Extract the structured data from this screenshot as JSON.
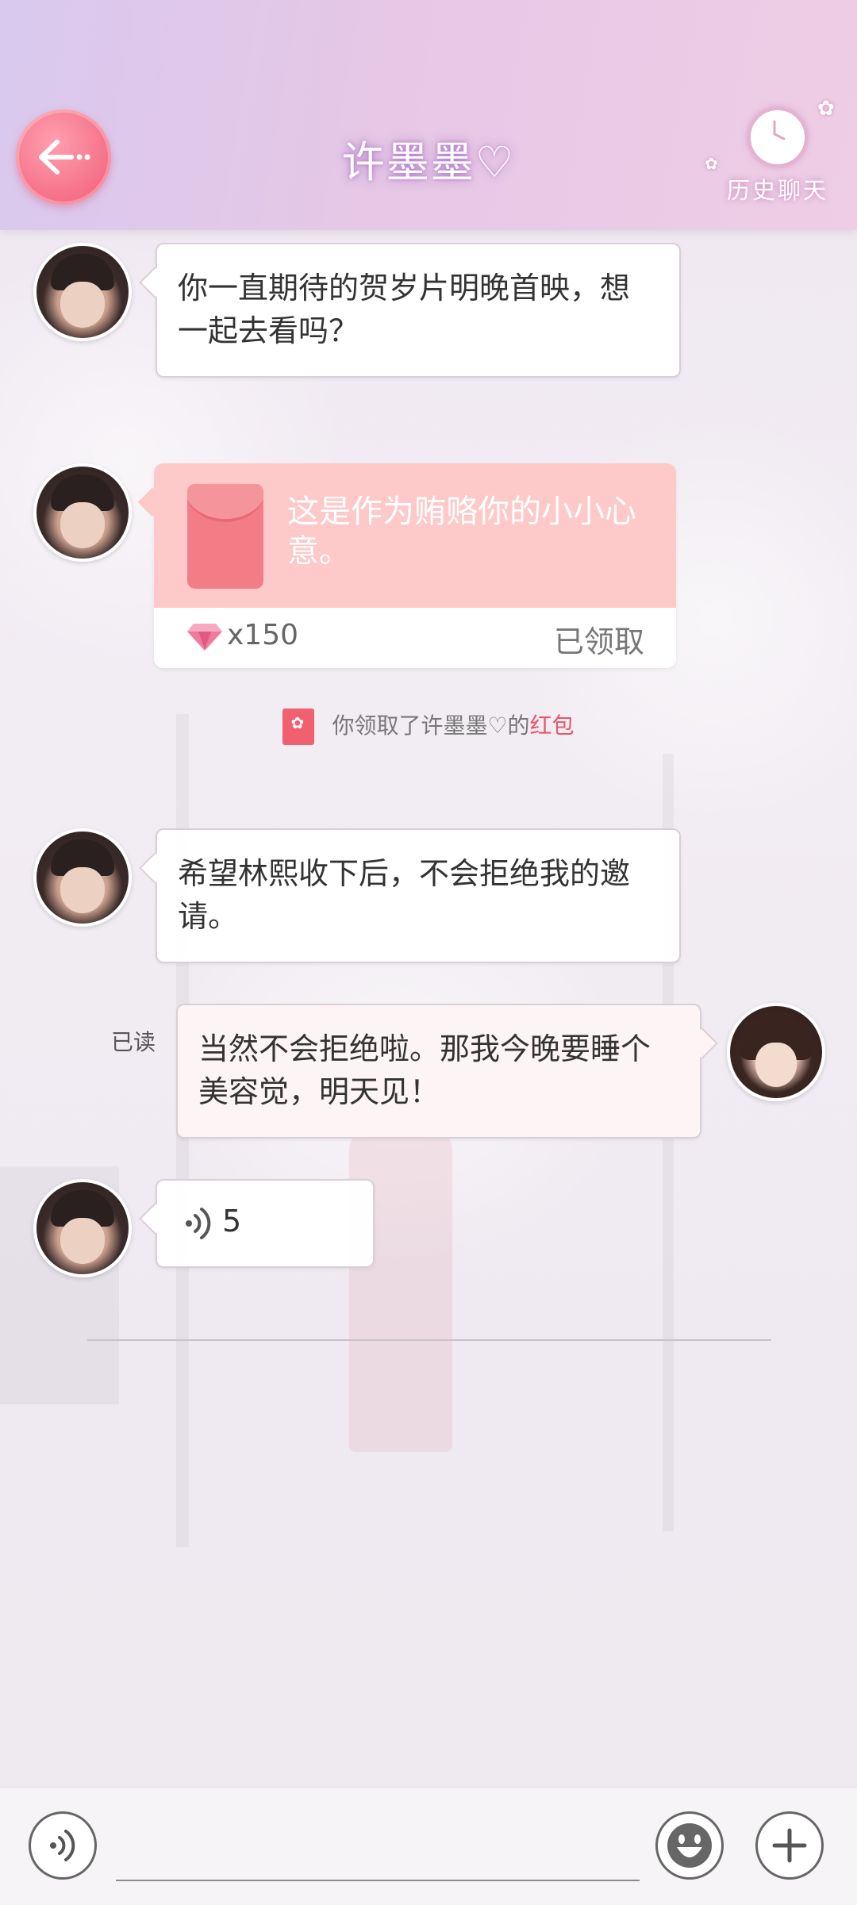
{
  "header": {
    "title": "许墨墨♡",
    "history_label": "历史聊天",
    "back_icon": "arrow-left-icon",
    "history_icon": "clock-icon",
    "colors": {
      "header_start": "#d9c9ee",
      "header_end": "#efcde6",
      "back_button": "#f56f86"
    }
  },
  "messages": [
    {
      "sender": "许墨墨",
      "side": "left",
      "text": "你一直期待的贺岁片明晚首映，想一起去看吗？"
    },
    {
      "sender": "许墨墨",
      "side": "left",
      "type": "red_packet",
      "packet_text": "这是作为贿赂你的小小心意。",
      "amount": "x150",
      "status": "已领取",
      "reward_icon": "diamond-icon"
    },
    {
      "type": "system",
      "notice_prefix": "你领取了许墨墨♡的",
      "notice_highlight": "红包"
    },
    {
      "sender": "许墨墨",
      "side": "left",
      "text": "希望林熙收下后，不会拒绝我的邀请。"
    },
    {
      "sender": "me",
      "side": "right",
      "read_label": "已读",
      "text": "当然不会拒绝啦。那我今晚要睡个美容觉，明天见！"
    },
    {
      "sender": "许墨墨",
      "side": "left",
      "type": "voice",
      "duration": "5",
      "voice_icon": "voice-wave-icon"
    }
  ],
  "input_bar": {
    "voice_icon": "voice-input-icon",
    "emoji_icon": "emoji-icon",
    "plus_icon": "plus-icon"
  }
}
